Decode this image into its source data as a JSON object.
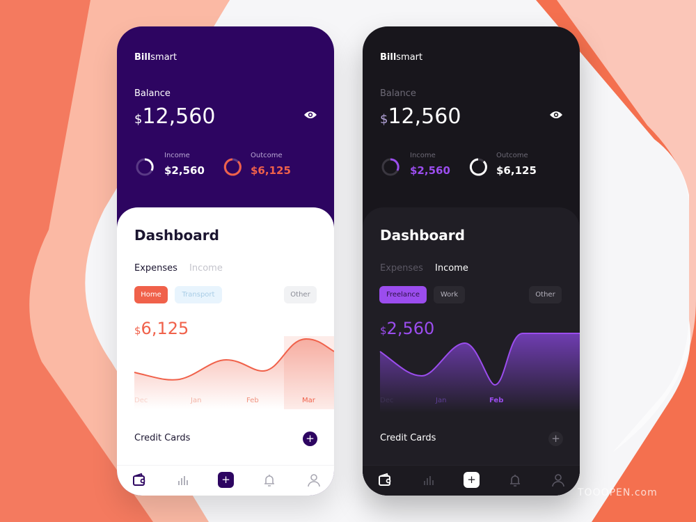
{
  "colors": {
    "purple": "#2d0561",
    "coral": "#f0614a",
    "violet": "#9b4dee",
    "dark": "#18161c"
  },
  "light": {
    "brand_bold": "Bill",
    "brand_rest": "smart",
    "balance_label": "Balance",
    "currency": "$",
    "balance": "12,560",
    "income_label": "Income",
    "income_value": "$2,560",
    "outcome_label": "Outcome",
    "outcome_value": "$6,125",
    "dashboard_title": "Dashboard",
    "tabs": [
      "Expenses",
      "Income"
    ],
    "active_tab": "Expenses",
    "chips": [
      "Home",
      "Transport",
      "Other"
    ],
    "active_chip": "Home",
    "amount": "6,125",
    "months": [
      "Dec",
      "Jan",
      "Feb",
      "Mar"
    ],
    "credit_cards": "Credit Cards",
    "plus": "+",
    "nav": [
      "wallet-icon",
      "bar-chart-icon",
      "add-icon",
      "bell-icon",
      "user-icon"
    ]
  },
  "dark": {
    "brand_bold": "Bill",
    "brand_rest": "smart",
    "balance_label": "Balance",
    "currency": "$",
    "balance": "12,560",
    "income_label": "Income",
    "income_value": "$2,560",
    "outcome_label": "Outcome",
    "outcome_value": "$6,125",
    "dashboard_title": "Dashboard",
    "tabs": [
      "Expenses",
      "Income"
    ],
    "active_tab": "Income",
    "chips": [
      "Freelance",
      "Work",
      "Other"
    ],
    "active_chip": "Freelance",
    "amount": "2,560",
    "months": [
      "Dec",
      "Jan",
      "Feb"
    ],
    "credit_cards": "Credit Cards",
    "plus": "+",
    "nav": [
      "wallet-icon",
      "bar-chart-icon",
      "add-icon",
      "bell-icon",
      "user-icon"
    ]
  },
  "watermark": "TOOOPEN.com"
}
